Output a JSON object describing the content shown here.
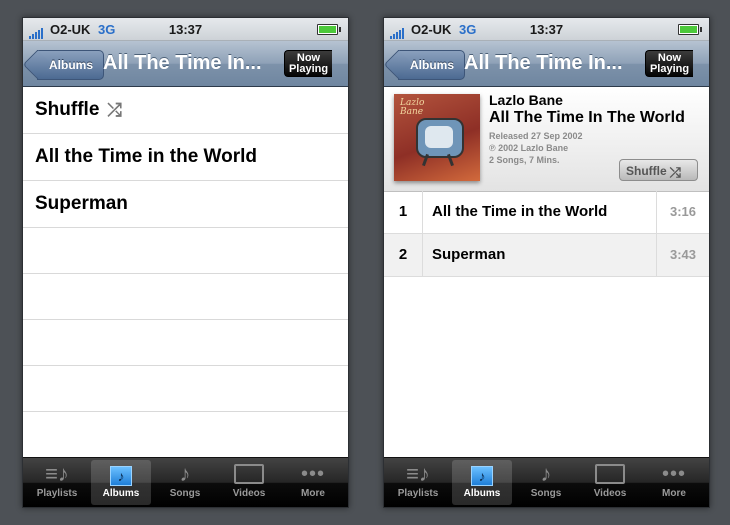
{
  "left": {
    "status": {
      "carrier": "O2-UK",
      "network": "3G",
      "time": "13:37",
      "battery_level": 1.0
    },
    "nav": {
      "back_label": "Albums",
      "title": "All The Time In...",
      "now_playing": [
        "Now",
        "Playing"
      ]
    },
    "rows": [
      "Shuffle",
      "All the Time in the World",
      "Superman"
    ],
    "shuffle_icon": "shuffle-icon",
    "tabs": [
      "Playlists",
      "Albums",
      "Songs",
      "Videos",
      "More"
    ]
  },
  "right": {
    "status": {
      "carrier": "O2-UK",
      "network": "3G",
      "time": "13:37",
      "battery_level": 1.0
    },
    "nav": {
      "back_label": "Albums",
      "title": "All The Time In...",
      "now_playing": [
        "Now",
        "Playing"
      ]
    },
    "album": {
      "cover_text": [
        "Lazlo",
        "Bane"
      ],
      "artist": "Lazlo Bane",
      "title": "All The Time In The World",
      "released": "Released 27 Sep 2002",
      "copyright": "℗ 2002 Lazlo Bane",
      "summary": "2 Songs, 7 Mins.",
      "shuffle_label": "Shuffle"
    },
    "tracks": [
      {
        "num": "1",
        "name": "All the Time in the World",
        "duration": "3:16"
      },
      {
        "num": "2",
        "name": "Superman",
        "duration": "3:43"
      }
    ],
    "tabs": [
      "Playlists",
      "Albums",
      "Songs",
      "Videos",
      "More"
    ]
  },
  "colors": {
    "accent_blue": "#3aa6f3",
    "nav_blue": "#7d92aa",
    "background": "#4d5156"
  }
}
